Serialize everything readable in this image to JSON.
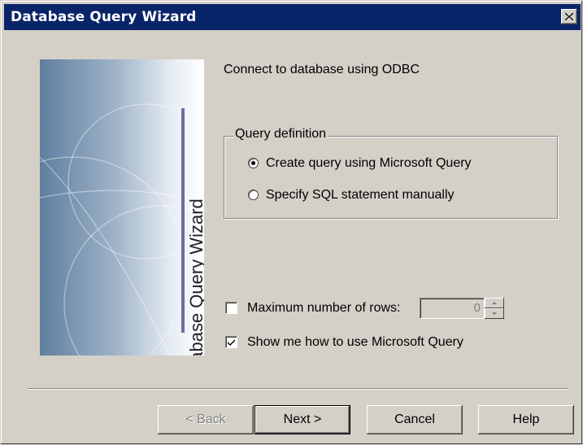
{
  "window": {
    "title": "Database Query Wizard",
    "close_glyph": "×"
  },
  "side_image": {
    "caption": "Database Query Wizard"
  },
  "connection_text": "Connect to database using  ODBC",
  "query_definition": {
    "legend": "Query definition",
    "options": [
      {
        "label": "Create query using Microsoft Query",
        "selected": true
      },
      {
        "label": "Specify SQL statement manually",
        "selected": false
      }
    ]
  },
  "max_rows": {
    "label": "Maximum number of rows:",
    "checked": false,
    "value": "0"
  },
  "show_me": {
    "label": "Show me how to use Microsoft Query",
    "checked": true
  },
  "buttons": {
    "back": "< Back",
    "next": "Next >",
    "cancel": "Cancel",
    "help": "Help"
  },
  "icons": {
    "close": "close-icon",
    "check": "checkmark-icon",
    "radio_dot": "radio-dot-icon",
    "spin_up": "arrow-up-icon",
    "spin_down": "arrow-down-icon"
  },
  "colors": {
    "title_bar": "#0a246a",
    "face": "#d4d0c8"
  }
}
